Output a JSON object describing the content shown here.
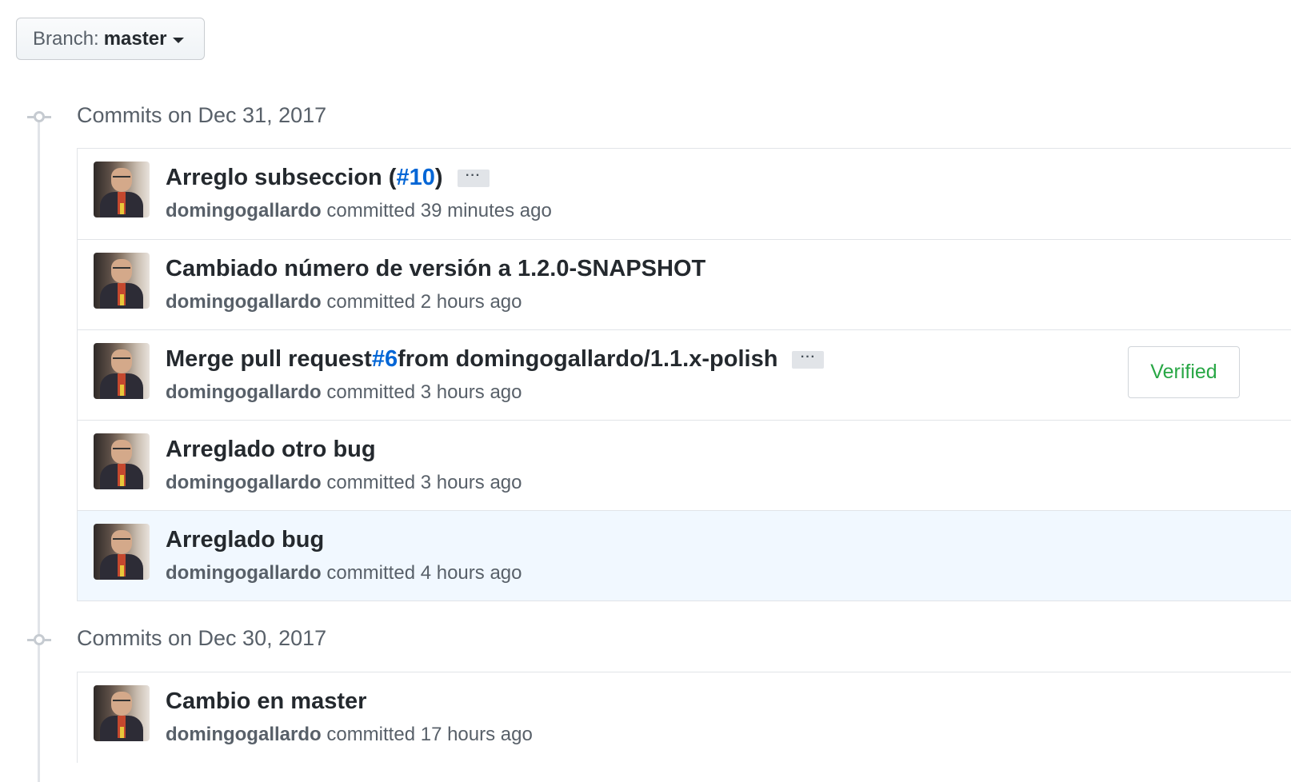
{
  "branch": {
    "label": "Branch:",
    "value": "master"
  },
  "groups": [
    {
      "title": "Commits on Dec 31, 2017",
      "commits": [
        {
          "title_pre": "Arreglo subseccion (",
          "link": "#10",
          "title_post": ")",
          "has_ellipsis": true,
          "ellipsis": "···",
          "author": "domingogallardo",
          "action": "committed",
          "time": "39 minutes ago"
        },
        {
          "title_pre": "Cambiado número de versión a 1.2.0-SNAPSHOT",
          "link": "",
          "title_post": "",
          "has_ellipsis": false,
          "author": "domingogallardo",
          "action": "committed",
          "time": "2 hours ago"
        },
        {
          "title_pre": "Merge pull request ",
          "link": "#6",
          "title_post": " from domingogallardo/1.1.x-polish",
          "has_ellipsis": true,
          "ellipsis": "···",
          "author": "domingogallardo",
          "action": "committed",
          "time": "3 hours ago",
          "badge": "Verified"
        },
        {
          "title_pre": "Arreglado otro bug",
          "link": "",
          "title_post": "",
          "has_ellipsis": false,
          "author": "domingogallardo",
          "action": "committed",
          "time": "3 hours ago"
        },
        {
          "title_pre": "Arreglado bug",
          "link": "",
          "title_post": "",
          "has_ellipsis": false,
          "author": "domingogallardo",
          "action": "committed",
          "time": "4 hours ago",
          "highlighted": true
        }
      ]
    },
    {
      "title": "Commits on Dec 30, 2017",
      "commits": [
        {
          "title_pre": "Cambio en master",
          "link": "",
          "title_post": "",
          "has_ellipsis": false,
          "author": "domingogallardo",
          "action": "committed",
          "time": "17 hours ago"
        }
      ]
    }
  ],
  "colors": {
    "link": "#0366d6",
    "verified": "#28a745",
    "highlight_row": "#f1f8ff"
  }
}
